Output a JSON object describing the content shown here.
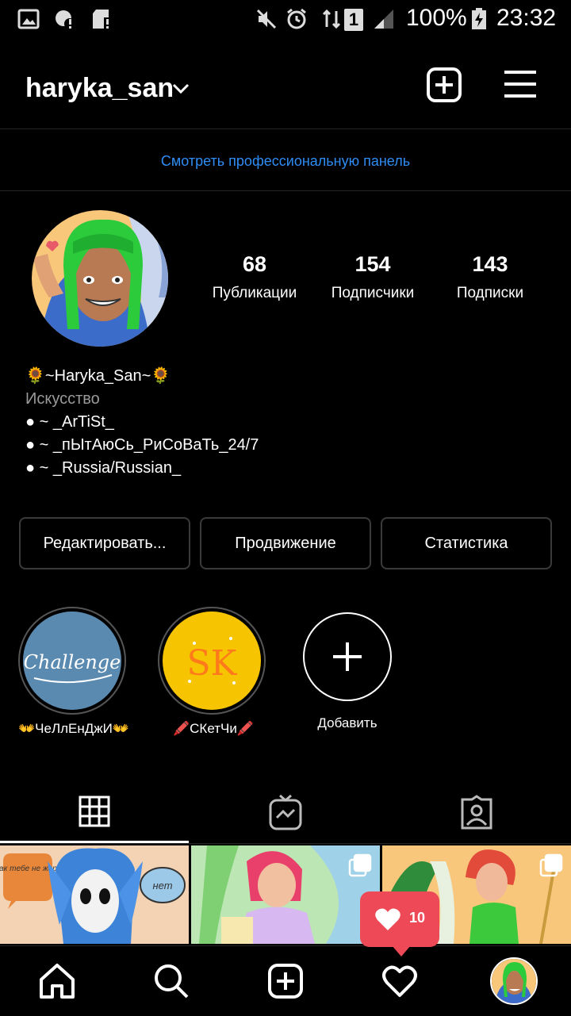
{
  "status_bar": {
    "battery": "100%",
    "time": "23:32",
    "sim": "1"
  },
  "header": {
    "username": "haryka_san"
  },
  "pro_link": "Смотреть профессиональную панель",
  "stats": [
    {
      "num": "68",
      "label": "Публикации"
    },
    {
      "num": "154",
      "label": "Подписчики"
    },
    {
      "num": "143",
      "label": "Подписки"
    }
  ],
  "bio": {
    "name": "🌻~Haryka_San~🌻",
    "category": "Искусство",
    "lines": [
      "● ~ _ArTiSt_",
      "● ~ _пЫтАюСь_РиСоВаТь_24/7",
      "● ~ _Russia/Russian_"
    ]
  },
  "buttons": {
    "edit": "Редактировать...",
    "promote": "Продвижение",
    "stats": "Статистика"
  },
  "highlights": [
    {
      "label": "👐ЧеЛлЕнДжИ👐",
      "cover_text": "Challenge",
      "cover_color": "#5b8ab0"
    },
    {
      "label": "🖍️СКетЧи🖍️",
      "cover_text": "SK",
      "cover_color": "#f6c400"
    },
    {
      "label": "Добавить"
    }
  ],
  "posts": [
    {
      "speech_left": "Чувак тебе не жарко?",
      "speech_right": "нет"
    },
    {},
    {}
  ],
  "notification": {
    "likes": "10"
  },
  "colors": {
    "link": "#2f8cf5",
    "notif": "#ed4956",
    "bg": "#000000"
  }
}
